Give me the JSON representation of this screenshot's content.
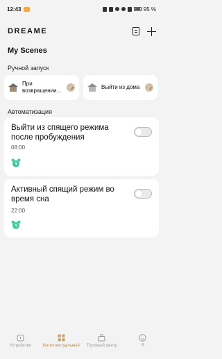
{
  "status": {
    "time": "12:43",
    "battery": "95 %"
  },
  "header": {
    "logo": "DREAME"
  },
  "page_title": "My Scenes",
  "manual": {
    "section_label": "Ручной запуск",
    "cards": [
      {
        "label": "При возвращении..."
      },
      {
        "label": "Выйти из дома"
      }
    ]
  },
  "automation": {
    "section_label": "Автоматизация",
    "cards": [
      {
        "title": "Выйти из спящего режима после пробуждения",
        "time": "08:00"
      },
      {
        "title": "Активный спящий режим во время сна",
        "time": "22:00"
      }
    ]
  },
  "tabs": [
    {
      "label": "Устройство",
      "icon": "device-icon"
    },
    {
      "label": "Интеллектуальный",
      "icon": "smart-grid-icon"
    },
    {
      "label": "Торговый центр",
      "icon": "shopping-bag-icon"
    },
    {
      "label": "Я",
      "icon": "profile-icon"
    }
  ],
  "colors": {
    "accent": "#b98f57",
    "alarm_green": "#3fc9a0",
    "background": "#f3f3f3"
  }
}
